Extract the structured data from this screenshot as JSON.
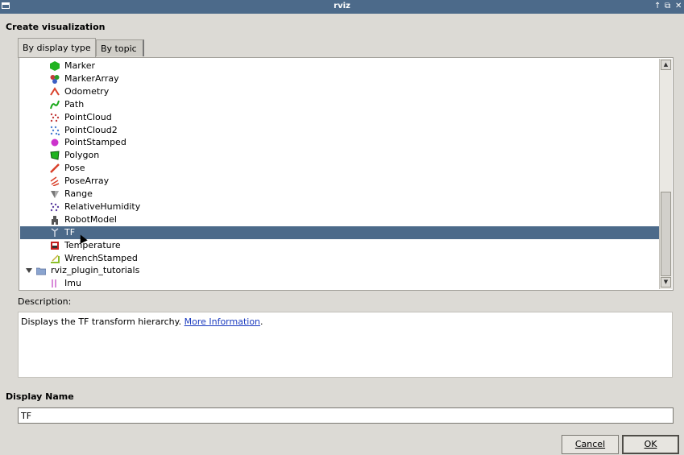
{
  "window": {
    "title": "rviz",
    "controls": [
      "↑",
      "⧉",
      "✕"
    ]
  },
  "dialog": {
    "heading": "Create visualization",
    "tabs": [
      {
        "label": "By display type",
        "active": true
      },
      {
        "label": "By topic",
        "active": false
      }
    ],
    "tree": {
      "items": [
        {
          "label": "Marker",
          "icon": "marker-icon",
          "color": "#1fb31f"
        },
        {
          "label": "MarkerArray",
          "icon": "marker-array-icon",
          "color": "#c43b3b"
        },
        {
          "label": "Odometry",
          "icon": "odometry-icon",
          "color": "#d9402a"
        },
        {
          "label": "Path",
          "icon": "path-icon",
          "color": "#1aa81a"
        },
        {
          "label": "PointCloud",
          "icon": "pointcloud-icon",
          "color": "#c23a3a"
        },
        {
          "label": "PointCloud2",
          "icon": "pointcloud2-icon",
          "color": "#4a7fd1"
        },
        {
          "label": "PointStamped",
          "icon": "point-stamped-icon",
          "color": "#cc33cc"
        },
        {
          "label": "Polygon",
          "icon": "polygon-icon",
          "color": "#1fb31f"
        },
        {
          "label": "Pose",
          "icon": "pose-icon",
          "color": "#d9402a"
        },
        {
          "label": "PoseArray",
          "icon": "pose-array-icon",
          "color": "#d9402a"
        },
        {
          "label": "Range",
          "icon": "range-icon",
          "color": "#777777"
        },
        {
          "label": "RelativeHumidity",
          "icon": "relative-humidity-icon",
          "color": "#5b3fa0"
        },
        {
          "label": "RobotModel",
          "icon": "robot-model-icon",
          "color": "#555555"
        },
        {
          "label": "TF",
          "icon": "tf-icon",
          "color": "#555555",
          "selected": true
        },
        {
          "label": "Temperature",
          "icon": "temperature-icon",
          "color": "#c41e1e"
        },
        {
          "label": "WrenchStamped",
          "icon": "wrench-stamped-icon",
          "color": "#8bbf2a"
        },
        {
          "label": "rviz_plugin_tutorials",
          "icon": "folder-icon",
          "color": "#8aa4cf",
          "group": true
        },
        {
          "label": "Imu",
          "icon": "imu-icon",
          "color": "#d98ad9"
        }
      ]
    },
    "description": {
      "label": "Description:",
      "text": "Displays the TF transform hierarchy.",
      "link": "More Information",
      "suffix": "."
    },
    "display_name": {
      "label": "Display Name",
      "value": "TF"
    },
    "buttons": {
      "cancel": "Cancel",
      "ok": "OK"
    }
  }
}
